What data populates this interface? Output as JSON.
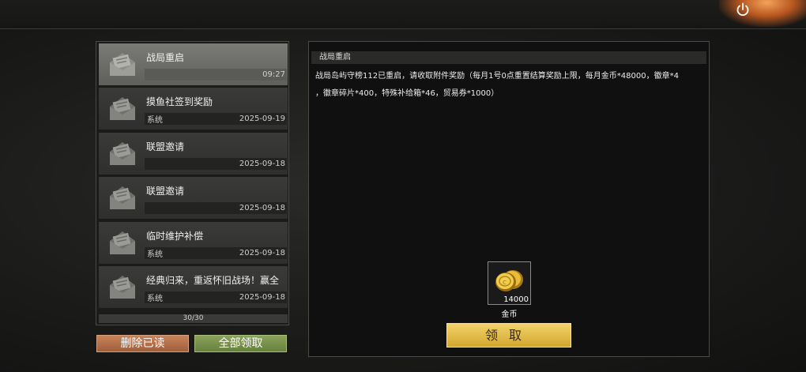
{
  "mails": [
    {
      "title": "战局重启",
      "sender": "",
      "date": "09:27",
      "selected": true
    },
    {
      "title": "摸鱼社签到奖励",
      "sender": "系统",
      "date": "2025-09-19",
      "selected": false
    },
    {
      "title": "联盟邀请",
      "sender": "",
      "date": "2025-09-18",
      "selected": false
    },
    {
      "title": "联盟邀请",
      "sender": "",
      "date": "2025-09-18",
      "selected": false
    },
    {
      "title": "临时维护补偿",
      "sender": "系统",
      "date": "2025-09-18",
      "selected": false
    },
    {
      "title": "经典归来，重返怀旧战场！赢全",
      "sender": "系统",
      "date": "2025-09-18",
      "selected": false
    }
  ],
  "list_count": "30/30",
  "buttons": {
    "delete_read": "删除已读",
    "claim_all": "全部领取",
    "claim": "领取"
  },
  "detail": {
    "title": "战局重启",
    "body_line1": "战局岛屿守榜112已重启，请收取附件奖励（每月1号0点重置结算奖励上限，每月金币*48000，徽章*4",
    "body_line2": "，徽章碎片*400，特殊补给箱*46，贸易券*1000）"
  },
  "reward": {
    "icon": "gold-coins-icon",
    "quantity": "14000",
    "name": "金币"
  },
  "colors": {
    "delete_button": "#b57148",
    "claim_all_button": "#789148",
    "claim_button": "#e2bb48"
  }
}
